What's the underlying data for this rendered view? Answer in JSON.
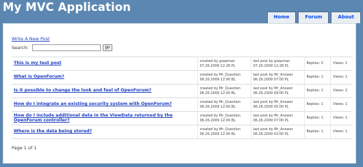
{
  "app": {
    "title": "My MVC Application"
  },
  "menu": [
    {
      "label": "Home"
    },
    {
      "label": "Forum"
    },
    {
      "label": "About"
    }
  ],
  "forum": {
    "write_link": "Write A New Post",
    "search_label": "Search:",
    "search_value": "",
    "search_placeholder": "",
    "go_label": "go",
    "threads": [
      {
        "subject": "This is my test post",
        "created_by": "created by gsepman",
        "created_at": "07.26.2009 12:28 PL",
        "last_by": "last post by gsepman",
        "last_at": "07.26.2009 12:28 PL",
        "replies": "Replies: 0",
        "views": "Views: 1"
      },
      {
        "subject": "What is OpenForum?",
        "created_by": "created by Mr_Question",
        "created_at": "06.26.2009 12:00 BL",
        "last_by": "last post by Mr_Answer",
        "last_at": "06.26.2009 07:00 PL",
        "replies": "Replies: 1",
        "views": "Views: 1"
      },
      {
        "subject": "Is it possible to change the look and feel of OpenForum?",
        "created_by": "created by Mr_Question",
        "created_at": "06.26.2009 12:00 BL",
        "last_by": "last post by Mr_Answer",
        "last_at": "06.26.2009 09:00 PL",
        "replies": "Replies: 1",
        "views": "Views: 2"
      },
      {
        "subject": "How do I integrate an existing security system with OpenForum?",
        "created_by": "created by Mr_Question",
        "created_at": "06.26.2009 12:00 BL",
        "last_by": "last post by Mr_Answer",
        "last_at": "06.26.2009 05:00 PL",
        "replies": "Replies: 1",
        "views": "Views: 1"
      },
      {
        "subject": "How do I include additional data in the ViewData returned by the OpenForum controller?",
        "created_by": "created by Mr_Question",
        "created_at": "06.26.2009 12:00 BL",
        "last_by": "last post by Mr_Answer",
        "last_at": "06.26.2009 07:00 PL",
        "replies": "Replies: 1",
        "views": "Views: 1"
      },
      {
        "subject": "Where is the data being stored?",
        "created_by": "created by Mr_Question",
        "created_at": "06.26.2009 12:00 BL",
        "last_by": "last post by Mr_Answer",
        "last_at": "06.26.2009 03:00 PL",
        "replies": "Replies: 1",
        "views": "Views: 1"
      }
    ],
    "pager": "Page 1 of 1"
  }
}
